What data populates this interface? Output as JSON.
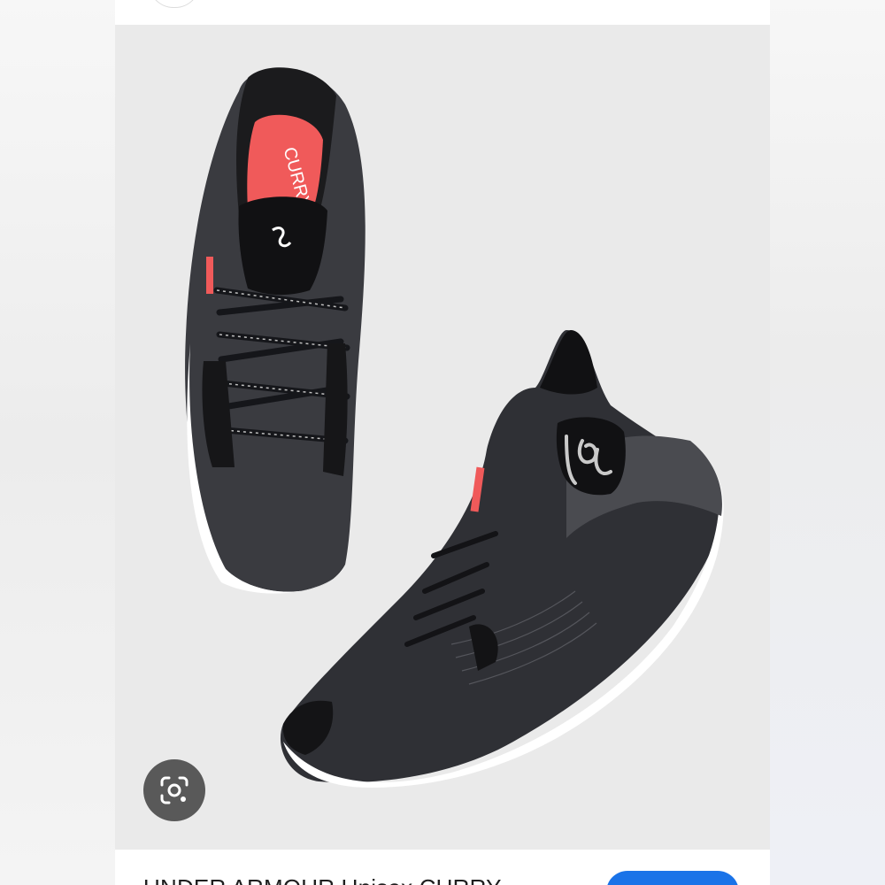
{
  "result": {
    "title": "UNDER ARMOUR Unisex CURRY"
  },
  "image": {
    "background": "#eaeaea",
    "insole_text": "CURRY",
    "lens_icon": "google-lens-icon",
    "accent_color": "#f05a5a"
  },
  "colors": {
    "visit_button": "#1a73e8",
    "lens_button": "#595959"
  }
}
